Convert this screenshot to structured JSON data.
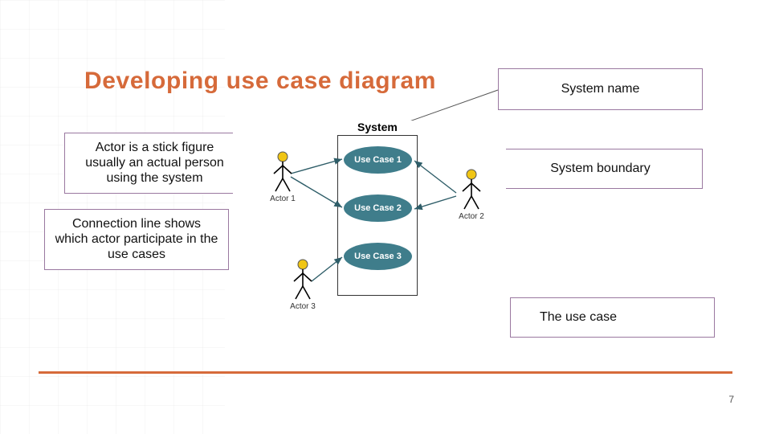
{
  "title": "Developing use case diagram",
  "callouts": {
    "actor": "Actor is a stick figure usually an actual  person using the system",
    "connection": "Connection line shows which actor participate in the use cases",
    "system_name": "System name",
    "system_boundary": "System boundary",
    "use_case": "The use case"
  },
  "diagram": {
    "system_label": "System",
    "use_cases": [
      "Use Case 1",
      "Use Case 2",
      "Use Case 3"
    ],
    "actors": [
      "Actor 1",
      "Actor 2",
      "Actor 3"
    ]
  },
  "page_number": "7",
  "colors": {
    "accent": "#d66a3a",
    "uc_fill": "#3f7d8b",
    "callout_border": "#9a78a0",
    "actor_head": "#f0c514"
  }
}
